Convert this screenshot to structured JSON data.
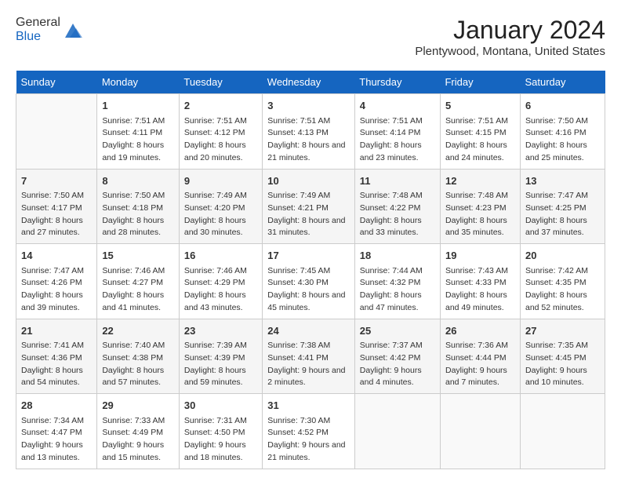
{
  "header": {
    "logo_line1": "General",
    "logo_line2": "Blue",
    "month_title": "January 2024",
    "location": "Plentywood, Montana, United States"
  },
  "weekdays": [
    "Sunday",
    "Monday",
    "Tuesday",
    "Wednesday",
    "Thursday",
    "Friday",
    "Saturday"
  ],
  "weeks": [
    [
      {
        "day": "",
        "sunrise": "",
        "sunset": "",
        "daylight": ""
      },
      {
        "day": "1",
        "sunrise": "Sunrise: 7:51 AM",
        "sunset": "Sunset: 4:11 PM",
        "daylight": "Daylight: 8 hours and 19 minutes."
      },
      {
        "day": "2",
        "sunrise": "Sunrise: 7:51 AM",
        "sunset": "Sunset: 4:12 PM",
        "daylight": "Daylight: 8 hours and 20 minutes."
      },
      {
        "day": "3",
        "sunrise": "Sunrise: 7:51 AM",
        "sunset": "Sunset: 4:13 PM",
        "daylight": "Daylight: 8 hours and 21 minutes."
      },
      {
        "day": "4",
        "sunrise": "Sunrise: 7:51 AM",
        "sunset": "Sunset: 4:14 PM",
        "daylight": "Daylight: 8 hours and 23 minutes."
      },
      {
        "day": "5",
        "sunrise": "Sunrise: 7:51 AM",
        "sunset": "Sunset: 4:15 PM",
        "daylight": "Daylight: 8 hours and 24 minutes."
      },
      {
        "day": "6",
        "sunrise": "Sunrise: 7:50 AM",
        "sunset": "Sunset: 4:16 PM",
        "daylight": "Daylight: 8 hours and 25 minutes."
      }
    ],
    [
      {
        "day": "7",
        "sunrise": "Sunrise: 7:50 AM",
        "sunset": "Sunset: 4:17 PM",
        "daylight": "Daylight: 8 hours and 27 minutes."
      },
      {
        "day": "8",
        "sunrise": "Sunrise: 7:50 AM",
        "sunset": "Sunset: 4:18 PM",
        "daylight": "Daylight: 8 hours and 28 minutes."
      },
      {
        "day": "9",
        "sunrise": "Sunrise: 7:49 AM",
        "sunset": "Sunset: 4:20 PM",
        "daylight": "Daylight: 8 hours and 30 minutes."
      },
      {
        "day": "10",
        "sunrise": "Sunrise: 7:49 AM",
        "sunset": "Sunset: 4:21 PM",
        "daylight": "Daylight: 8 hours and 31 minutes."
      },
      {
        "day": "11",
        "sunrise": "Sunrise: 7:48 AM",
        "sunset": "Sunset: 4:22 PM",
        "daylight": "Daylight: 8 hours and 33 minutes."
      },
      {
        "day": "12",
        "sunrise": "Sunrise: 7:48 AM",
        "sunset": "Sunset: 4:23 PM",
        "daylight": "Daylight: 8 hours and 35 minutes."
      },
      {
        "day": "13",
        "sunrise": "Sunrise: 7:47 AM",
        "sunset": "Sunset: 4:25 PM",
        "daylight": "Daylight: 8 hours and 37 minutes."
      }
    ],
    [
      {
        "day": "14",
        "sunrise": "Sunrise: 7:47 AM",
        "sunset": "Sunset: 4:26 PM",
        "daylight": "Daylight: 8 hours and 39 minutes."
      },
      {
        "day": "15",
        "sunrise": "Sunrise: 7:46 AM",
        "sunset": "Sunset: 4:27 PM",
        "daylight": "Daylight: 8 hours and 41 minutes."
      },
      {
        "day": "16",
        "sunrise": "Sunrise: 7:46 AM",
        "sunset": "Sunset: 4:29 PM",
        "daylight": "Daylight: 8 hours and 43 minutes."
      },
      {
        "day": "17",
        "sunrise": "Sunrise: 7:45 AM",
        "sunset": "Sunset: 4:30 PM",
        "daylight": "Daylight: 8 hours and 45 minutes."
      },
      {
        "day": "18",
        "sunrise": "Sunrise: 7:44 AM",
        "sunset": "Sunset: 4:32 PM",
        "daylight": "Daylight: 8 hours and 47 minutes."
      },
      {
        "day": "19",
        "sunrise": "Sunrise: 7:43 AM",
        "sunset": "Sunset: 4:33 PM",
        "daylight": "Daylight: 8 hours and 49 minutes."
      },
      {
        "day": "20",
        "sunrise": "Sunrise: 7:42 AM",
        "sunset": "Sunset: 4:35 PM",
        "daylight": "Daylight: 8 hours and 52 minutes."
      }
    ],
    [
      {
        "day": "21",
        "sunrise": "Sunrise: 7:41 AM",
        "sunset": "Sunset: 4:36 PM",
        "daylight": "Daylight: 8 hours and 54 minutes."
      },
      {
        "day": "22",
        "sunrise": "Sunrise: 7:40 AM",
        "sunset": "Sunset: 4:38 PM",
        "daylight": "Daylight: 8 hours and 57 minutes."
      },
      {
        "day": "23",
        "sunrise": "Sunrise: 7:39 AM",
        "sunset": "Sunset: 4:39 PM",
        "daylight": "Daylight: 8 hours and 59 minutes."
      },
      {
        "day": "24",
        "sunrise": "Sunrise: 7:38 AM",
        "sunset": "Sunset: 4:41 PM",
        "daylight": "Daylight: 9 hours and 2 minutes."
      },
      {
        "day": "25",
        "sunrise": "Sunrise: 7:37 AM",
        "sunset": "Sunset: 4:42 PM",
        "daylight": "Daylight: 9 hours and 4 minutes."
      },
      {
        "day": "26",
        "sunrise": "Sunrise: 7:36 AM",
        "sunset": "Sunset: 4:44 PM",
        "daylight": "Daylight: 9 hours and 7 minutes."
      },
      {
        "day": "27",
        "sunrise": "Sunrise: 7:35 AM",
        "sunset": "Sunset: 4:45 PM",
        "daylight": "Daylight: 9 hours and 10 minutes."
      }
    ],
    [
      {
        "day": "28",
        "sunrise": "Sunrise: 7:34 AM",
        "sunset": "Sunset: 4:47 PM",
        "daylight": "Daylight: 9 hours and 13 minutes."
      },
      {
        "day": "29",
        "sunrise": "Sunrise: 7:33 AM",
        "sunset": "Sunset: 4:49 PM",
        "daylight": "Daylight: 9 hours and 15 minutes."
      },
      {
        "day": "30",
        "sunrise": "Sunrise: 7:31 AM",
        "sunset": "Sunset: 4:50 PM",
        "daylight": "Daylight: 9 hours and 18 minutes."
      },
      {
        "day": "31",
        "sunrise": "Sunrise: 7:30 AM",
        "sunset": "Sunset: 4:52 PM",
        "daylight": "Daylight: 9 hours and 21 minutes."
      },
      {
        "day": "",
        "sunrise": "",
        "sunset": "",
        "daylight": ""
      },
      {
        "day": "",
        "sunrise": "",
        "sunset": "",
        "daylight": ""
      },
      {
        "day": "",
        "sunrise": "",
        "sunset": "",
        "daylight": ""
      }
    ]
  ]
}
